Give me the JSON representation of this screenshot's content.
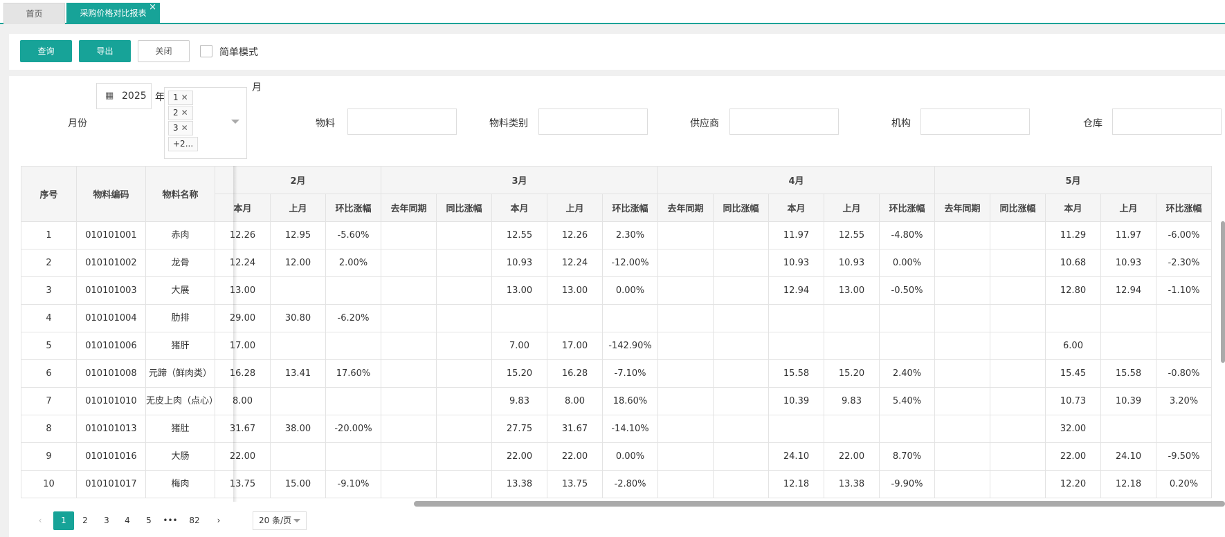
{
  "tabs": {
    "home": "首页",
    "active": "采购价格对比报表",
    "close": "×"
  },
  "toolbar": {
    "query": "查询",
    "export": "导出",
    "close": "关闭",
    "simple_mode": "简单模式"
  },
  "filters": {
    "month_label": "月份",
    "year_value": "2025",
    "year_suffix": "年",
    "month_suffix": "月",
    "month_tags": [
      "1",
      "2",
      "3"
    ],
    "month_more": "+2...",
    "material": "物料",
    "category": "物料类别",
    "supplier": "供应商",
    "org": "机构",
    "warehouse": "仓库"
  },
  "table": {
    "fixed_headers": [
      "序号",
      "物料编码",
      "物料名称"
    ],
    "month_groups": [
      {
        "name": "2月",
        "cols": [
          "本月",
          "上月",
          "环比涨幅"
        ]
      },
      {
        "name": "3月",
        "cols": [
          "去年同期",
          "同比涨幅",
          "本月",
          "上月",
          "环比涨幅"
        ]
      },
      {
        "name": "4月",
        "cols": [
          "去年同期",
          "同比涨幅",
          "本月",
          "上月",
          "环比涨幅"
        ]
      },
      {
        "name": "5月",
        "cols": [
          "去年同期",
          "同比涨幅",
          "本月",
          "上月",
          "环比涨幅"
        ]
      }
    ],
    "rows": [
      [
        "1",
        "010101001",
        "赤肉",
        "12.26",
        "12.95",
        "-5.60%",
        "",
        "",
        "12.55",
        "12.26",
        "2.30%",
        "",
        "",
        "11.97",
        "12.55",
        "-4.80%",
        "",
        "",
        "11.29",
        "11.97",
        "-6.00%"
      ],
      [
        "2",
        "010101002",
        "龙骨",
        "12.24",
        "12.00",
        "2.00%",
        "",
        "",
        "10.93",
        "12.24",
        "-12.00%",
        "",
        "",
        "10.93",
        "10.93",
        "0.00%",
        "",
        "",
        "10.68",
        "10.93",
        "-2.30%"
      ],
      [
        "3",
        "010101003",
        "大展",
        "13.00",
        "",
        "",
        "",
        "",
        "13.00",
        "13.00",
        "0.00%",
        "",
        "",
        "12.94",
        "13.00",
        "-0.50%",
        "",
        "",
        "12.80",
        "12.94",
        "-1.10%"
      ],
      [
        "4",
        "010101004",
        "肋排",
        "29.00",
        "30.80",
        "-6.20%",
        "",
        "",
        "",
        "",
        "",
        "",
        "",
        "",
        "",
        "",
        "",
        "",
        "",
        "",
        ""
      ],
      [
        "5",
        "010101006",
        "猪肝",
        "17.00",
        "",
        "",
        "",
        "",
        "7.00",
        "17.00",
        "-142.90%",
        "",
        "",
        "",
        "",
        "",
        "",
        "",
        "6.00",
        "",
        ""
      ],
      [
        "6",
        "010101008",
        "元蹄（鲜肉类）",
        "16.28",
        "13.41",
        "17.60%",
        "",
        "",
        "15.20",
        "16.28",
        "-7.10%",
        "",
        "",
        "15.58",
        "15.20",
        "2.40%",
        "",
        "",
        "15.45",
        "15.58",
        "-0.80%"
      ],
      [
        "7",
        "010101010",
        "无皮上肉（点心）",
        "8.00",
        "",
        "",
        "",
        "",
        "9.83",
        "8.00",
        "18.60%",
        "",
        "",
        "10.39",
        "9.83",
        "5.40%",
        "",
        "",
        "10.73",
        "10.39",
        "3.20%"
      ],
      [
        "8",
        "010101013",
        "猪肚",
        "31.67",
        "38.00",
        "-20.00%",
        "",
        "",
        "27.75",
        "31.67",
        "-14.10%",
        "",
        "",
        "",
        "",
        "",
        "",
        "",
        "32.00",
        "",
        ""
      ],
      [
        "9",
        "010101016",
        "大肠",
        "22.00",
        "",
        "",
        "",
        "",
        "22.00",
        "22.00",
        "0.00%",
        "",
        "",
        "24.10",
        "22.00",
        "8.70%",
        "",
        "",
        "22.00",
        "24.10",
        "-9.50%"
      ],
      [
        "10",
        "010101017",
        "梅肉",
        "13.75",
        "15.00",
        "-9.10%",
        "",
        "",
        "13.38",
        "13.75",
        "-2.80%",
        "",
        "",
        "12.18",
        "13.38",
        "-9.90%",
        "",
        "",
        "12.20",
        "12.18",
        "0.20%"
      ]
    ]
  },
  "pagination": {
    "pages": [
      "1",
      "2",
      "3",
      "4",
      "5",
      "•••",
      "82"
    ],
    "prev": "‹",
    "next": "›",
    "page_size": "20 条/页"
  },
  "colors": {
    "accent": "#17a398"
  }
}
